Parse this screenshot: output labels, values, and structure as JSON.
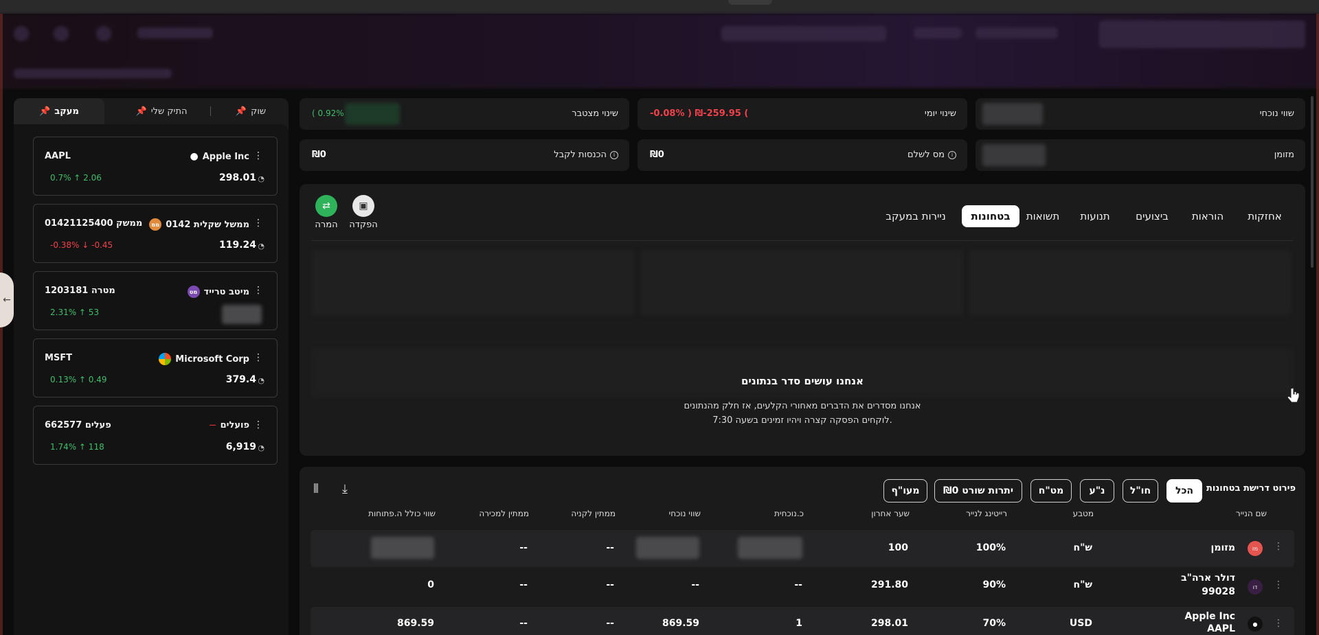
{
  "watchlist": {
    "tabs": [
      {
        "label": "מעקב",
        "active": true
      },
      {
        "label": "התיק שלי",
        "active": false
      },
      {
        "label": "שוק",
        "active": false
      }
    ],
    "items": [
      {
        "symbol": "AAPL",
        "name": "Apple Inc",
        "price": "298.01",
        "change": "0.7% ↑ 2.06",
        "direction": "up",
        "logo_icon": "apple-logo"
      },
      {
        "symbol": "0142ממשק 1125400",
        "name": "ממשל שקלית 0142",
        "price": "119.24",
        "change": "-0.38% ↓ -0.45",
        "direction": "down",
        "logo_icon": "badge-logo",
        "logo_text": "ממ"
      },
      {
        "symbol": "1203181 מטרה",
        "name": "מיטב טרייד",
        "price": "",
        "change": "2.31% ↑ 53",
        "direction": "up",
        "logo_icon": "badge-logo",
        "logo_text": "מט"
      },
      {
        "symbol": "MSFT",
        "name": "Microsoft Corp",
        "price": "379.4",
        "change": "0.13% ↑ 0.49",
        "direction": "up",
        "logo_icon": "microsoft-logo"
      },
      {
        "symbol": "662577 פעלים",
        "name": "פועלים",
        "price": "6,919",
        "change": "1.74% ↑ 118",
        "direction": "up",
        "logo_icon": "bank-logo"
      }
    ]
  },
  "summary": {
    "current_value": {
      "label": "שווי נוכחי"
    },
    "daily_change": {
      "label": "שינוי יומי",
      "value": "-0.08% ) ₪-259.95 ("
    },
    "cumulative_change": {
      "label": "שינוי מצטבר",
      "value": "( 0.92%"
    },
    "cash": {
      "label": "מזומן"
    },
    "tax_to_pay": {
      "label": "מס לשלם",
      "value": "₪0"
    },
    "income_receivable": {
      "label": "הכנסות לקבל",
      "value": "₪0"
    }
  },
  "nav": {
    "tabs": [
      {
        "label": "אחזקות",
        "active": false
      },
      {
        "label": "הוראות",
        "active": false
      },
      {
        "label": "ביצועים",
        "active": false
      },
      {
        "label": "תנועות",
        "active": false
      },
      {
        "label": "תשואות",
        "active": false
      },
      {
        "label": "בטחונות",
        "active": true
      },
      {
        "label": "ניירות במעקב",
        "active": false
      }
    ],
    "actions": [
      {
        "label": "הפקדה",
        "icon": "deposit-icon"
      },
      {
        "label": "המרה",
        "icon": "convert-icon"
      }
    ]
  },
  "notice": {
    "title": "אנחנו עושים סדר בנתונים",
    "line1": "אנחנו מסדרים את הדברים מאחורי הקלעים, אז חלק מהנתונים",
    "line2": "לוקחים הפסקה קצרה ויהיו זמינים בשעה 7:30."
  },
  "collateral": {
    "title": "פירוט דרישת בטחונות",
    "filters": [
      {
        "label": "הכל",
        "active": true
      },
      {
        "label": "חו\"ל",
        "active": false
      },
      {
        "label": "נ\"ע",
        "active": false
      },
      {
        "label": "מט\"ח",
        "active": false
      },
      {
        "label": "יתרות שורט ₪0",
        "active": false
      },
      {
        "label": "מעו\"ף",
        "active": false
      }
    ],
    "columns": [
      "שם הנייר",
      "מטבע",
      "רייטינג לנייר",
      "שער אחרון",
      "כ.נוכחית",
      "שווי נוכחי",
      "ממתין לקניה",
      "ממתין למכירה",
      "שווי כולל ה.פתוחות"
    ],
    "rows": [
      {
        "name": "מזומן",
        "sub": "",
        "currency": "ש\"ח",
        "rating": "100%",
        "last": "100",
        "qty": "",
        "value": "",
        "pending_buy": "--",
        "pending_sell": "--",
        "total": "",
        "logo_text": "מז",
        "logo_color": "#e5554f"
      },
      {
        "name": "דולר ארה\"ב",
        "sub": "99028",
        "currency": "ש\"ח",
        "rating": "90%",
        "last": "291.80",
        "qty": "--",
        "value": "--",
        "pending_buy": "--",
        "pending_sell": "--",
        "total": "0",
        "logo_text": "דו",
        "logo_color": "#3a1f44"
      },
      {
        "name": "Apple Inc",
        "sub": "AAPL",
        "currency": "USD",
        "rating": "70%",
        "last": "298.01",
        "qty": "1",
        "value": "869.59",
        "pending_buy": "--",
        "pending_sell": "--",
        "total": "869.59",
        "logo_text": "",
        "logo_color": "#000000"
      }
    ]
  }
}
